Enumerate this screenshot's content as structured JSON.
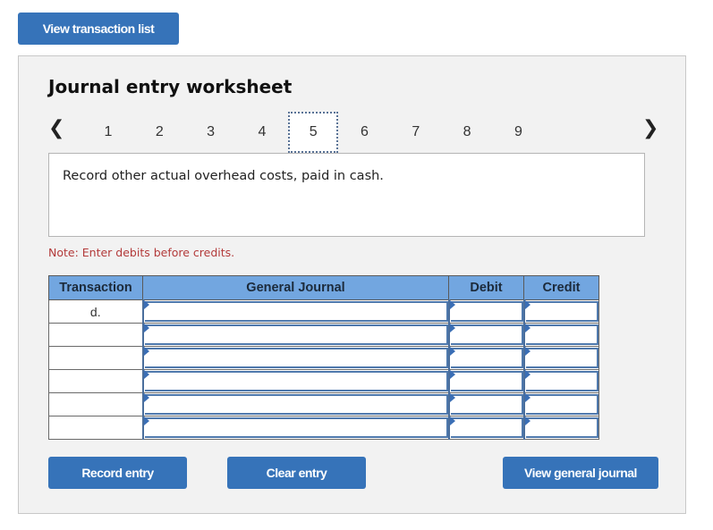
{
  "top_button": {
    "label": "View transaction list"
  },
  "worksheet": {
    "title": "Journal entry worksheet",
    "pager": {
      "prev_icon": "‹",
      "next_icon": "›",
      "pages": [
        "1",
        "2",
        "3",
        "4",
        "5",
        "6",
        "7",
        "8",
        "9"
      ],
      "active_page": "5"
    },
    "prompt": "Record other actual overhead costs, paid in cash.",
    "note": "Note: Enter debits before credits.",
    "table": {
      "headers": [
        "Transaction",
        "General Journal",
        "Debit",
        "Credit"
      ],
      "rows": [
        {
          "transaction": "d.",
          "account": "",
          "debit": "",
          "credit": ""
        },
        {
          "transaction": "",
          "account": "",
          "debit": "",
          "credit": ""
        },
        {
          "transaction": "",
          "account": "",
          "debit": "",
          "credit": ""
        },
        {
          "transaction": "",
          "account": "",
          "debit": "",
          "credit": ""
        },
        {
          "transaction": "",
          "account": "",
          "debit": "",
          "credit": ""
        },
        {
          "transaction": "",
          "account": "",
          "debit": "",
          "credit": ""
        }
      ]
    },
    "buttons": {
      "record": "Record entry",
      "clear": "Clear entry",
      "view_journal": "View general journal"
    }
  },
  "colors": {
    "button": "#3673b9",
    "header": "#72a6e0",
    "note": "#b33a3a"
  }
}
